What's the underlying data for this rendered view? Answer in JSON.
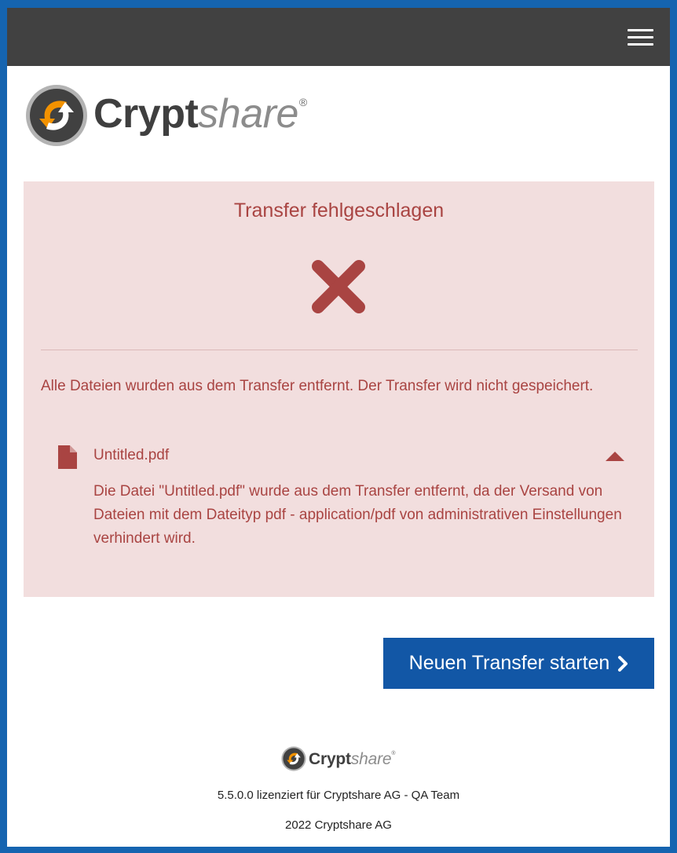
{
  "header": {
    "menu_icon": "hamburger-menu-icon"
  },
  "brand": {
    "name_bold": "Crypt",
    "name_light": "share",
    "registered": "®",
    "logo_icon": "cryptshare-logo-icon"
  },
  "alert": {
    "title": "Transfer fehlgeschlagen",
    "status_icon": "close-x-icon",
    "message": "Alle Dateien wurden aus dem Transfer entfernt. Der Transfer wird nicht gespeichert.",
    "files": [
      {
        "icon": "file-icon",
        "name": "Untitled.pdf",
        "toggle_icon": "caret-up-icon",
        "detail": "Die Datei \"Untitled.pdf\" wurde aus dem Transfer entfernt, da der Versand von Dateien mit dem Dateityp pdf - application/pdf von administrativen Einstellungen verhindert wird."
      }
    ]
  },
  "actions": {
    "start_new_transfer": "Neuen Transfer starten",
    "start_icon": "chevron-right-icon"
  },
  "footer": {
    "license": "5.5.0.0 lizenziert für Cryptshare AG - QA Team",
    "copyright": "2022 Cryptshare AG"
  },
  "colors": {
    "topbar": "#414141",
    "alert_bg": "#f2dede",
    "alert_text": "#a94442",
    "primary_button": "#1257a6",
    "page_border": "#1564b0",
    "logo_orange": "#f39200"
  }
}
